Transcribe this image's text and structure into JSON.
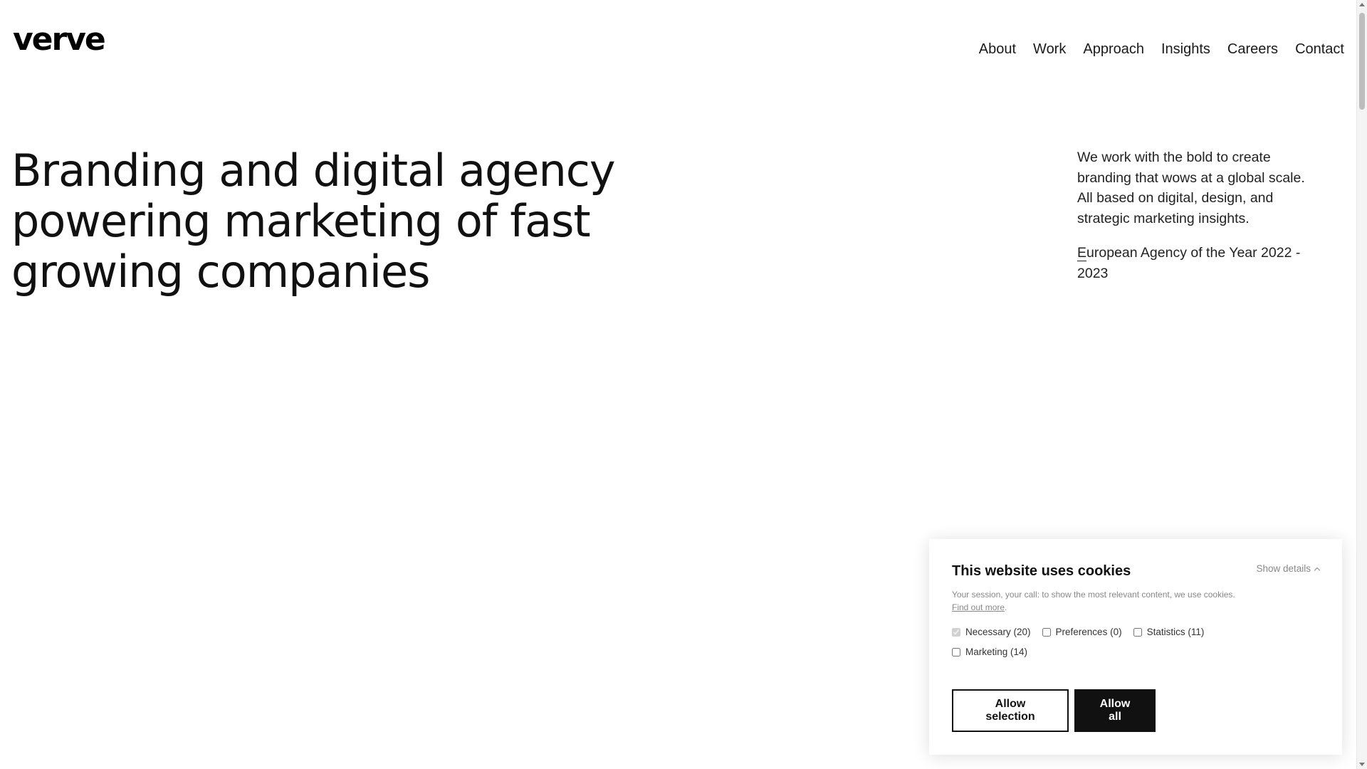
{
  "header": {
    "logo_text": "verve",
    "nav": [
      "About",
      "Work",
      "Approach",
      "Insights",
      "Careers",
      "Contact"
    ]
  },
  "hero": {
    "title": "Branding and digital agency powering marketing of fast growing companies",
    "description": "We work with the bold to create branding that wows at a global scale. All based on digital, design, and strategic marketing insights.",
    "award_first": "E",
    "award_rest": "uropean Agency of the Year 2022 - 2023"
  },
  "cookie": {
    "title": "This website uses cookies",
    "show_details": "Show details",
    "text": "Your session, your call: to show the most relevant content, we use cookies.",
    "find_out_more": "Find out more",
    "text_end": ".",
    "options": [
      {
        "label": "Necessary (20)",
        "checked": true,
        "disabled": true
      },
      {
        "label": "Preferences (0)",
        "checked": false,
        "disabled": false
      },
      {
        "label": "Statistics (11)",
        "checked": false,
        "disabled": false
      },
      {
        "label": "Marketing (14)",
        "checked": false,
        "disabled": false
      }
    ],
    "allow_selection": "Allow selection",
    "allow_all": "Allow all"
  }
}
